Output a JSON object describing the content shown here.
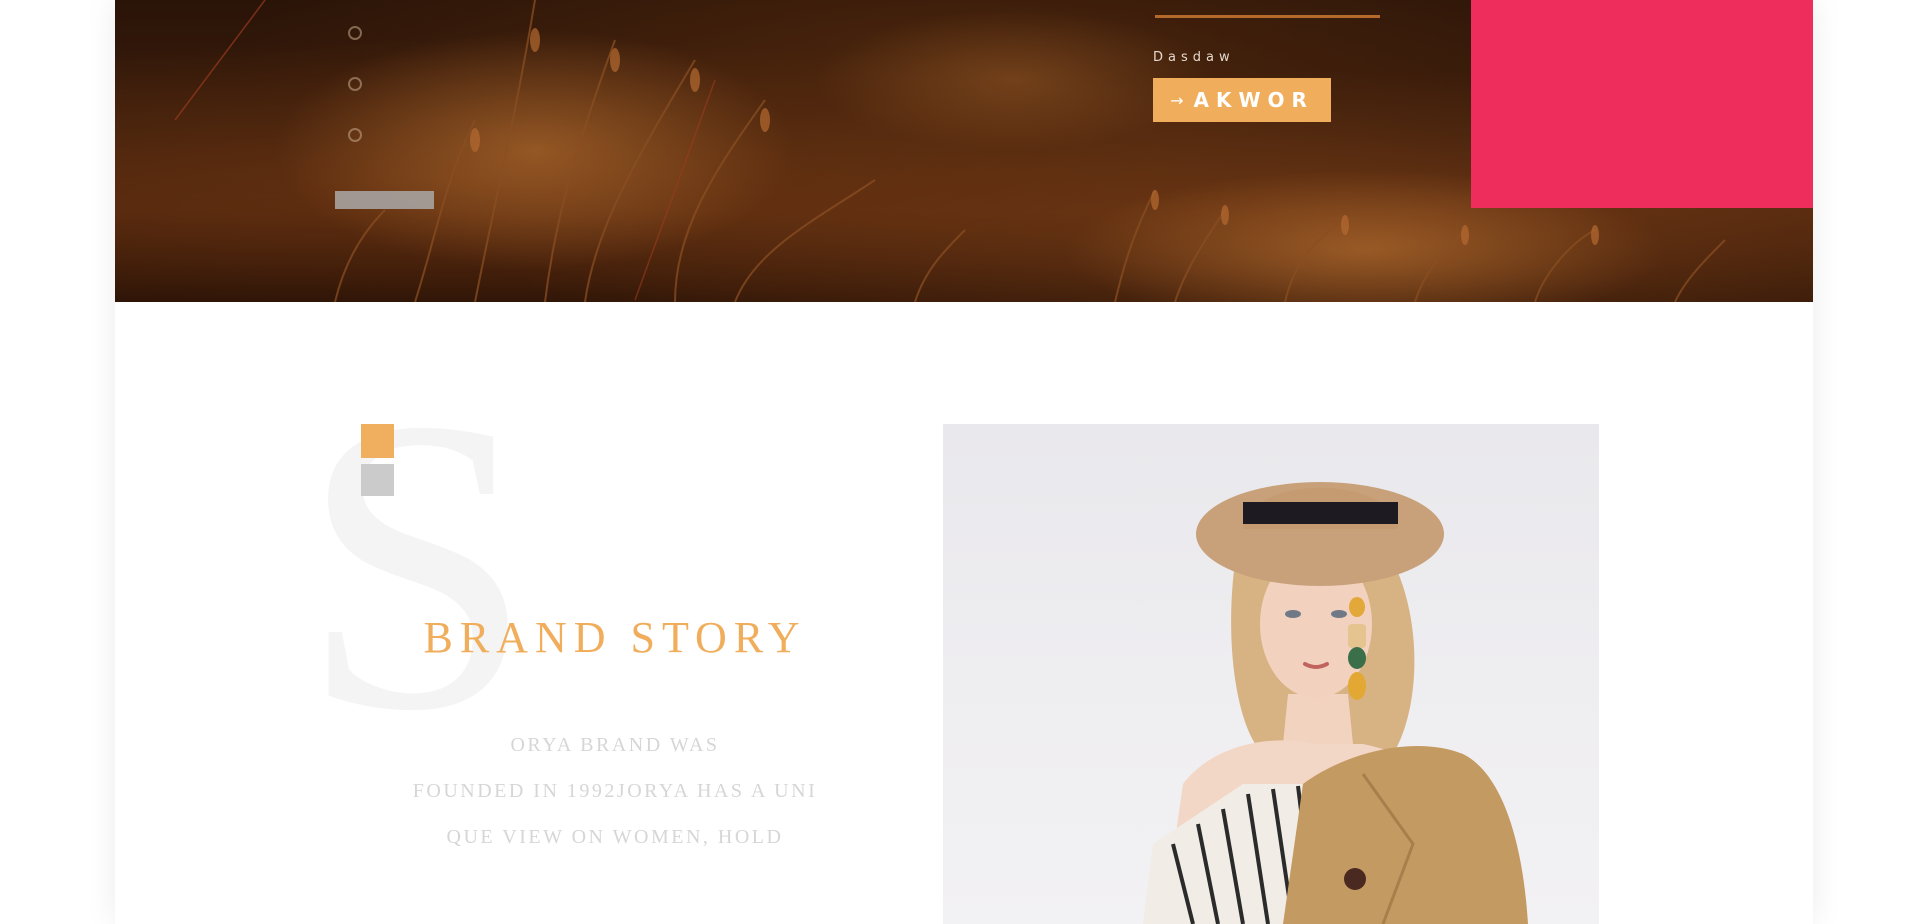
{
  "hero": {
    "subtitle": "Dasdaw",
    "button": {
      "arrow": "→",
      "label": "AKWOR"
    },
    "pager_dots": [
      {
        "active": false
      },
      {
        "active": false
      },
      {
        "active": false
      }
    ]
  },
  "brand": {
    "decor_letter": "S",
    "title": "BRAND STORY",
    "lines": [
      "ORYA BRAND WAS",
      "FOUNDED IN 1992JORYA HAS A UNI",
      "QUE VIEW ON WOMEN, HOLD"
    ]
  },
  "colors": {
    "accent_orange": "#f0ad5c",
    "accent_pink": "#ee2d5d",
    "square_grey": "#cbcbcb"
  },
  "icons": {
    "button_icon": "arrow-right-icon",
    "pager": "circle-outline-icon"
  }
}
